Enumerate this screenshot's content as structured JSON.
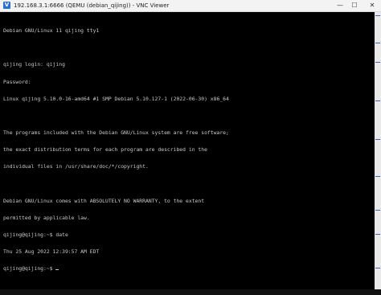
{
  "window": {
    "icon_letter": "V",
    "title": "192.168.3.1:6666 (QEMU (debian_qijing)) - VNC Viewer",
    "minimize_glyph": "—",
    "maximize_glyph": "☐",
    "close_glyph": "✕"
  },
  "terminal": {
    "lines": [
      "Debian GNU/Linux 11 qijing tty1",
      "",
      "qijing login: qijing",
      "Password:",
      "Linux qijing 5.10.0-16-amd64 #1 SMP Debian 5.10.127-1 (2022-06-30) x86_64",
      "",
      "The programs included with the Debian GNU/Linux system are free software;",
      "the exact distribution terms for each program are described in the",
      "individual files in /usr/share/doc/*/copyright.",
      "",
      "Debian GNU/Linux comes with ABSOLUTELY NO WARRANTY, to the extent",
      "permitted by applicable law.",
      "qijing@qijing:~$ date",
      "Thu 25 Aug 2022 12:39:57 AM EDT",
      "qijing@qijing:~$ "
    ]
  },
  "colors": {
    "terminal_bg": "#000000",
    "terminal_fg": "#c8c8c8",
    "titlebar_bg": "#f3f3f3"
  }
}
